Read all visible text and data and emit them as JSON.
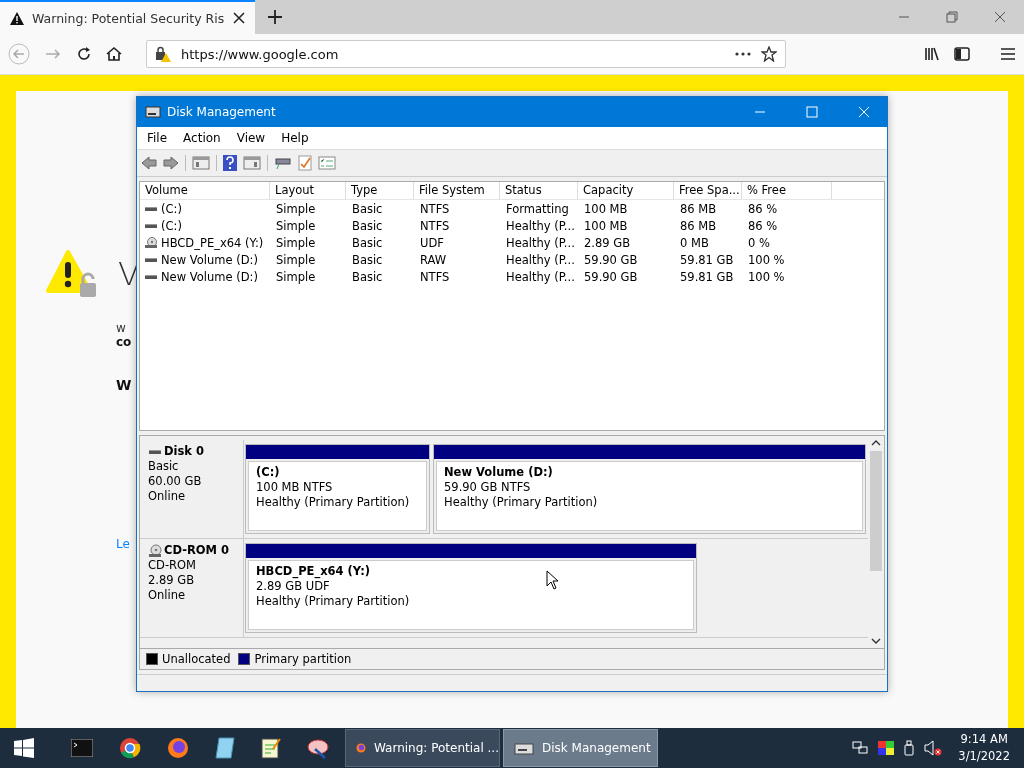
{
  "browser": {
    "tab": {
      "title": "Warning: Potential Security Ris",
      "selected": true
    },
    "address": "https://www.google.com"
  },
  "page": {
    "heading": "V",
    "intro": "w",
    "bold_line": "co",
    "subheading": "W",
    "link": "Le"
  },
  "window": {
    "title": "Disk Management",
    "menu": [
      "File",
      "Action",
      "View",
      "Help"
    ],
    "columns": [
      "Volume",
      "Layout",
      "Type",
      "File System",
      "Status",
      "Capacity",
      "Free Spa...",
      "% Free"
    ],
    "rows": [
      {
        "kind": "drive",
        "cells": [
          "(C:)",
          "Simple",
          "Basic",
          "NTFS",
          "Formatting",
          "100 MB",
          "86 MB",
          "86 %"
        ]
      },
      {
        "kind": "drive",
        "cells": [
          "(C:)",
          "Simple",
          "Basic",
          "NTFS",
          "Healthy (P...",
          "100 MB",
          "86 MB",
          "86 %"
        ]
      },
      {
        "kind": "cd",
        "cells": [
          "HBCD_PE_x64 (Y:)",
          "Simple",
          "Basic",
          "UDF",
          "Healthy (P...",
          "2.89 GB",
          "0 MB",
          "0 %"
        ]
      },
      {
        "kind": "drive",
        "cells": [
          "New Volume (D:)",
          "Simple",
          "Basic",
          "RAW",
          "Healthy (P...",
          "59.90 GB",
          "59.81 GB",
          "100 %"
        ]
      },
      {
        "kind": "drive",
        "cells": [
          "New Volume (D:)",
          "Simple",
          "Basic",
          "NTFS",
          "Healthy (P...",
          "59.90 GB",
          "59.81 GB",
          "100 %"
        ]
      }
    ],
    "disks": [
      {
        "kind": "fixed",
        "name": "Disk 0",
        "type": "Basic",
        "size": "60.00 GB",
        "state": "Online",
        "partitions": [
          {
            "name": "(C:)",
            "detail": "100 MB NTFS",
            "status": "Healthy (Primary Partition)"
          },
          {
            "name": "New Volume  (D:)",
            "detail": "59.90 GB NTFS",
            "status": "Healthy (Primary Partition)"
          }
        ]
      },
      {
        "kind": "cdrom",
        "name": "CD-ROM 0",
        "type": "CD-ROM",
        "size": "2.89 GB",
        "state": "Online",
        "partitions": [
          {
            "name": "HBCD_PE_x64  (Y:)",
            "detail": "2.89 GB UDF",
            "status": "Healthy (Primary Partition)"
          }
        ]
      }
    ],
    "legend": [
      {
        "label": "Unallocated",
        "color": "#000000"
      },
      {
        "label": "Primary partition",
        "color": "#000080"
      }
    ]
  },
  "taskbar": {
    "pinned": [
      {
        "kind": "terminal"
      },
      {
        "kind": "chrome"
      },
      {
        "kind": "firefox"
      },
      {
        "kind": "notepad"
      },
      {
        "kind": "editor"
      },
      {
        "kind": "paint"
      }
    ],
    "windows": [
      {
        "kind": "firefox",
        "label": "Warning: Potential ...",
        "selected": false
      },
      {
        "kind": "disk",
        "label": "Disk Management",
        "selected": true
      }
    ],
    "time": "9:14 AM",
    "date": "3/1/2022"
  }
}
